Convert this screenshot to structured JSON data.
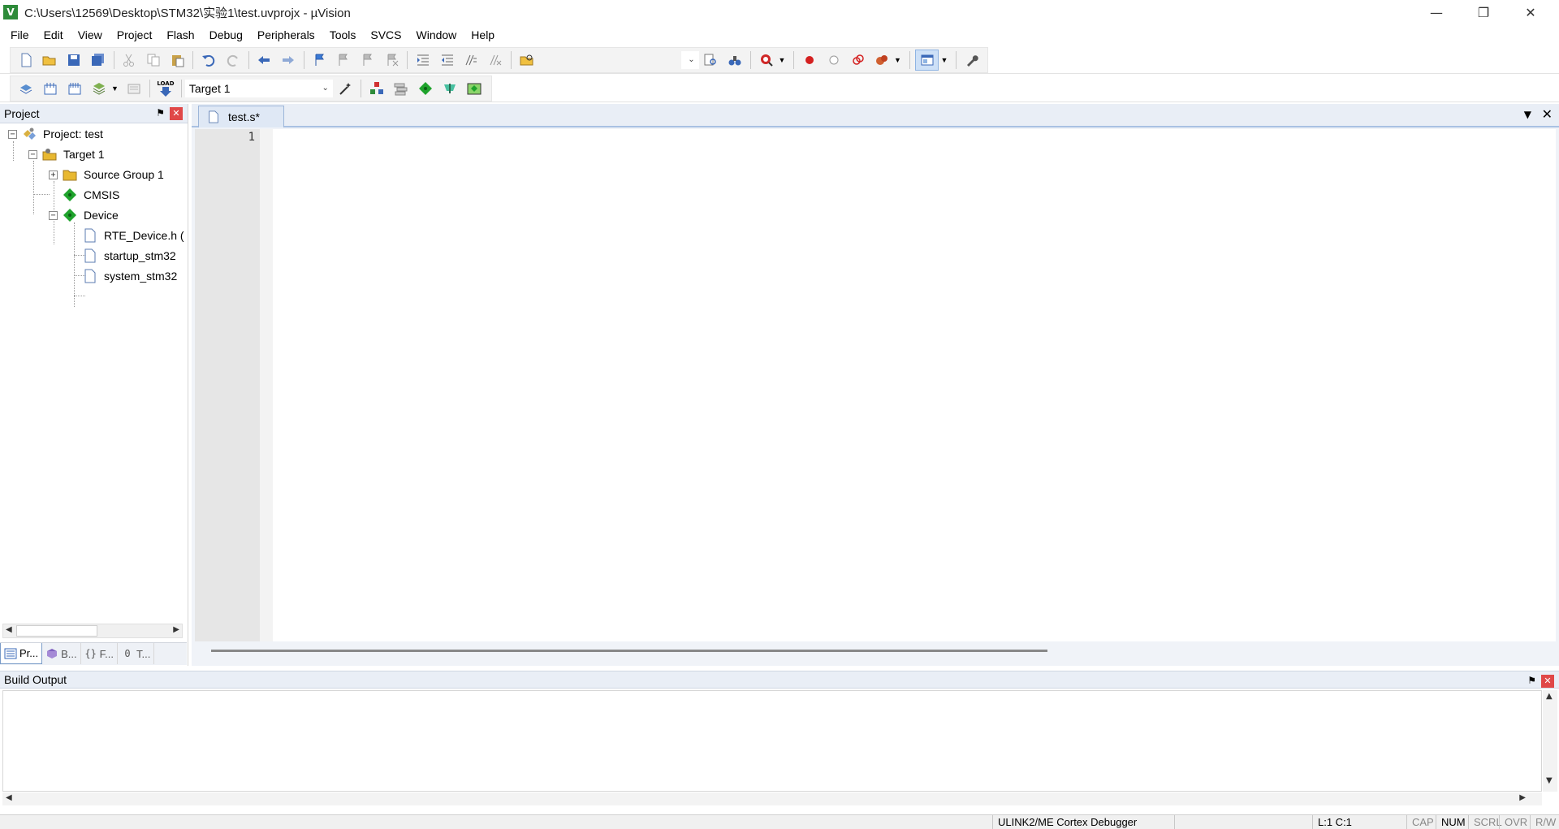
{
  "window": {
    "title": "C:\\Users\\12569\\Desktop\\STM32\\实验1\\test.uvprojx - µVision",
    "app_icon_letter": "V"
  },
  "menu": [
    "File",
    "Edit",
    "View",
    "Project",
    "Flash",
    "Debug",
    "Peripherals",
    "Tools",
    "SVCS",
    "Window",
    "Help"
  ],
  "toolbar2": {
    "load_label": "LOAD",
    "target_select": "Target 1"
  },
  "project_panel": {
    "title": "Project",
    "tree": {
      "root": "Project: test",
      "target": "Target 1",
      "source_group": "Source Group 1",
      "cmsis": "CMSIS",
      "device": "Device",
      "files": [
        "RTE_Device.h (",
        "startup_stm32",
        "system_stm32"
      ]
    },
    "tabs": [
      {
        "icon": "project-tab-icon",
        "label": "Pr..."
      },
      {
        "icon": "books-tab-icon",
        "label": "B..."
      },
      {
        "icon": "functions-tab-icon",
        "label": "F..."
      },
      {
        "icon": "templates-tab-icon",
        "label": "T..."
      }
    ],
    "tab_glyphs": {
      "functions": "{}",
      "templates": "0"
    }
  },
  "editor": {
    "tab_label": "test.s*",
    "line_numbers": [
      "1"
    ]
  },
  "build_output": {
    "title": "Build Output"
  },
  "statusbar": {
    "debugger": "ULINK2/ME Cortex Debugger",
    "position": "L:1 C:1",
    "cap": "CAP",
    "num": "NUM",
    "scrl": "SCRL",
    "ovr": "OVR",
    "rw": "R/W"
  },
  "colors": {
    "panel_header": "#e9eef6",
    "tree_folder": "#e8b830",
    "tree_diamond": "#1fa32c",
    "close_red": "#e04848"
  }
}
